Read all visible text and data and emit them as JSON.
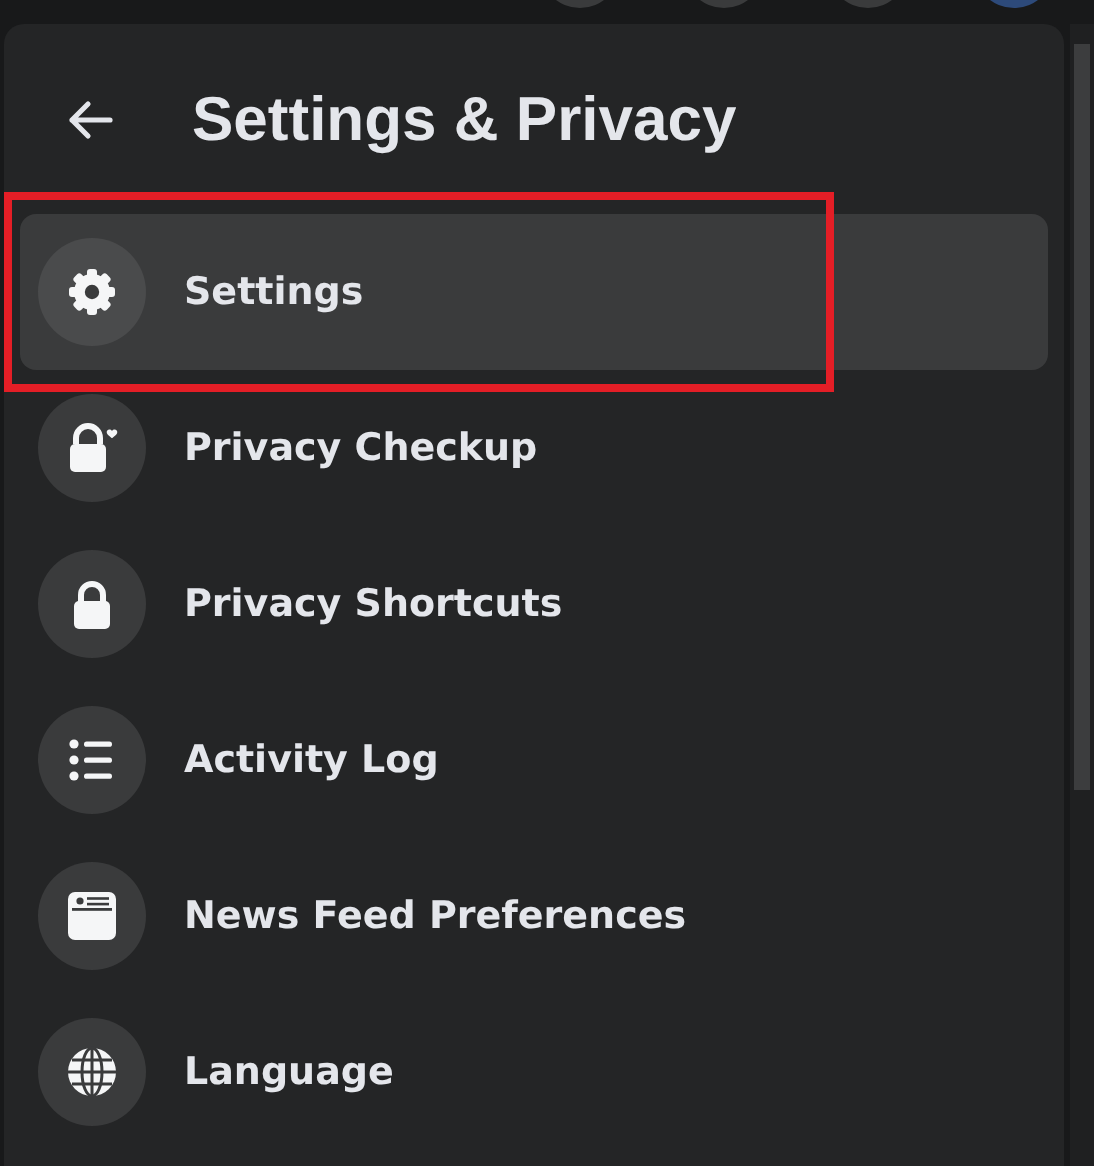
{
  "header": {
    "title": "Settings & Privacy"
  },
  "items": [
    {
      "label": "Settings",
      "kind": "gear",
      "selected": true,
      "highlighted": true
    },
    {
      "label": "Privacy Checkup",
      "kind": "lock-heart",
      "selected": false,
      "highlighted": false
    },
    {
      "label": "Privacy Shortcuts",
      "kind": "lock",
      "selected": false,
      "highlighted": false
    },
    {
      "label": "Activity Log",
      "kind": "list",
      "selected": false,
      "highlighted": false
    },
    {
      "label": "News Feed Preferences",
      "kind": "feed",
      "selected": false,
      "highlighted": false
    },
    {
      "label": "Language",
      "kind": "globe",
      "selected": false,
      "highlighted": false
    }
  ]
}
